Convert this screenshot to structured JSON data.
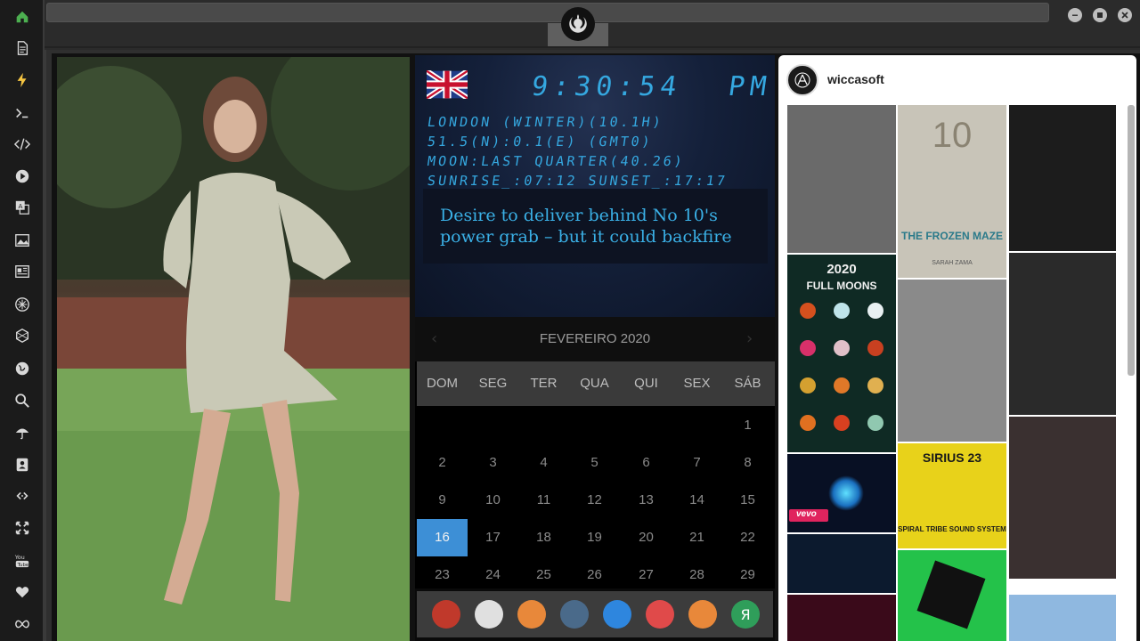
{
  "sidebar": {
    "items": [
      {
        "icon": "home-icon",
        "color": "#4caf50"
      },
      {
        "icon": "document-icon"
      },
      {
        "icon": "lightning-icon",
        "color": "#f5c542"
      },
      {
        "icon": "terminal-icon"
      },
      {
        "icon": "code-icon"
      },
      {
        "icon": "play-icon"
      },
      {
        "icon": "translate-icon"
      },
      {
        "icon": "image-icon"
      },
      {
        "icon": "news-icon"
      },
      {
        "icon": "rebel-icon"
      },
      {
        "icon": "hexagon-icon"
      },
      {
        "icon": "globe-icon"
      },
      {
        "icon": "search-icon"
      },
      {
        "icon": "umbrella-icon"
      },
      {
        "icon": "contacts-icon"
      },
      {
        "icon": "link-icon"
      },
      {
        "icon": "expand-icon"
      },
      {
        "icon": "youtube-icon"
      },
      {
        "icon": "heart-icon"
      },
      {
        "icon": "infinity-icon"
      }
    ]
  },
  "clock": {
    "time": "9:30:54",
    "ampm": "PM",
    "lines": [
      "LONDON (WINTER)(10.1H)",
      "51.5(N):0.1(E) (GMT0)",
      "MOON:LAST QUARTER(40.26)",
      "SUNRISE_:07:12 SUNSET_:17:17"
    ],
    "accent": "#35a8e0"
  },
  "news": {
    "headline": "Desire to deliver behind No 10's power grab – but it could backfire"
  },
  "calendar": {
    "prev": "‹",
    "next": "›",
    "month": "FEVEREIRO 2020",
    "weekdays": [
      "DOM",
      "SEG",
      "TER",
      "QUA",
      "QUI",
      "SEX",
      "SÁB"
    ],
    "first_weekday_index": 6,
    "days_shown": 29,
    "today": 16,
    "today_color": "#3d8fd6"
  },
  "dock": {
    "items": [
      {
        "icon": "triangle-app-icon",
        "color": "#c0392b"
      },
      {
        "icon": "newspaper-icon",
        "color": "#e0e0e0"
      },
      {
        "icon": "search-app-icon",
        "color": "#e8883a"
      },
      {
        "icon": "clock-app-icon",
        "color": "#4a6a8a"
      },
      {
        "icon": "globe-app-icon",
        "color": "#2e86de"
      },
      {
        "icon": "calendar-app-icon",
        "color": "#e04a4a"
      },
      {
        "icon": "arrow-app-icon",
        "color": "#e8883a"
      },
      {
        "icon": "ya-app-icon",
        "color": "#2f9e5a",
        "glyph": "Я"
      }
    ]
  },
  "feed": {
    "username": "wiccasoft",
    "tiles": [
      {
        "name": "tile-woman-coat",
        "bg": "#6a6a6a"
      },
      {
        "name": "tile-book-frozen-maze",
        "bg": "#c8c4b8",
        "number": "10",
        "title": "THE FROZEN MAZE",
        "author": "SARAH ZAMA"
      },
      {
        "name": "tile-man-cape",
        "bg": "#1c1c1c"
      },
      {
        "name": "tile-full-moons",
        "bg": "#0f2a24",
        "title": "2020",
        "subtitle": "FULL MOONS"
      },
      {
        "name": "tile-woman-dress-bw",
        "bg": "#8a8a8a"
      },
      {
        "name": "tile-ornate-bw",
        "bg": "#2a2a2a"
      },
      {
        "name": "tile-vevo-lights",
        "bg": "#081024",
        "label": "vevo"
      },
      {
        "name": "tile-sirius-23",
        "bg": "#e8d21a",
        "title": "SIRIUS 23",
        "subtitle": "SPIRAL TRIBE SOUND SYSTEM"
      },
      {
        "name": "tile-fashion-show",
        "bg": "#3a3030"
      },
      {
        "name": "tile-concert",
        "bg": "#0c1a2e"
      },
      {
        "name": "tile-green-art",
        "bg": "#24c24a"
      },
      {
        "name": "tile-church",
        "bg": "#8fb8e0"
      },
      {
        "name": "tile-stage-red",
        "bg": "#3a0a1a"
      }
    ]
  }
}
